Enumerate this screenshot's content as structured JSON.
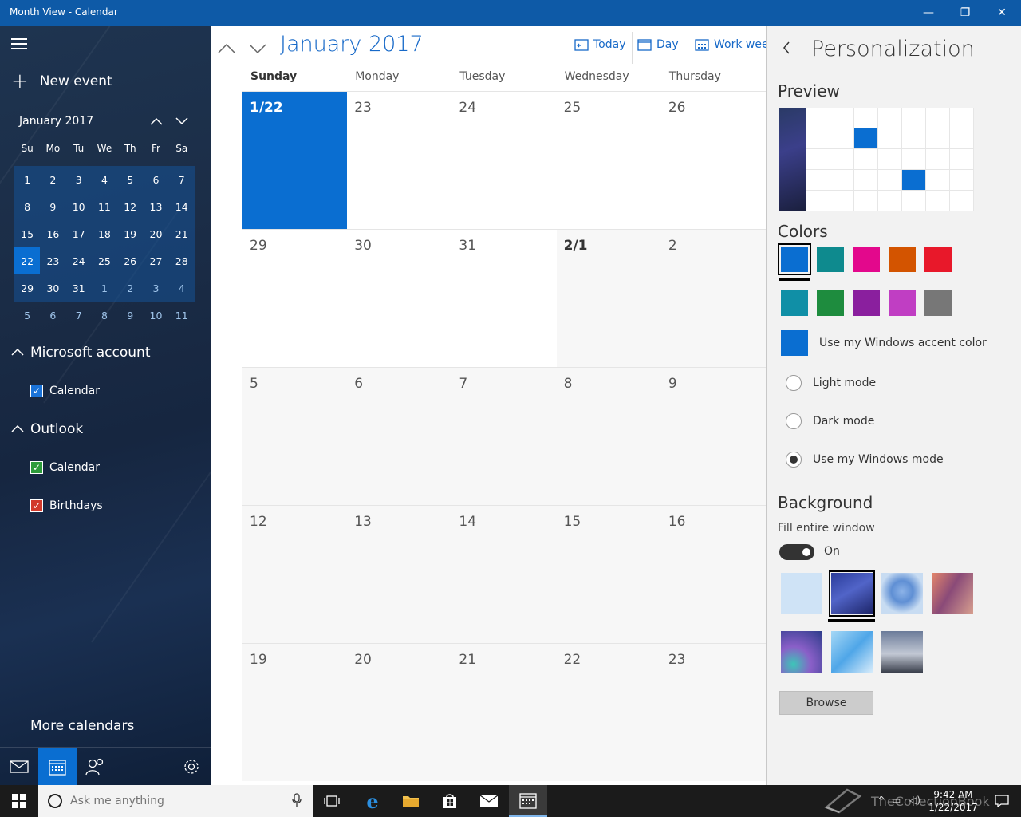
{
  "window": {
    "title": "Month View - Calendar",
    "min": "—",
    "max": "❐",
    "close": "✕"
  },
  "sidebar": {
    "new_event": "New event",
    "mini_title": "January 2017",
    "dow": [
      "Su",
      "Mo",
      "Tu",
      "We",
      "Th",
      "Fr",
      "Sa"
    ],
    "weeks": [
      [
        "1",
        "2",
        "3",
        "4",
        "5",
        "6",
        "7"
      ],
      [
        "8",
        "9",
        "10",
        "11",
        "12",
        "13",
        "14"
      ],
      [
        "15",
        "16",
        "17",
        "18",
        "19",
        "20",
        "21"
      ],
      [
        "22",
        "23",
        "24",
        "25",
        "26",
        "27",
        "28"
      ],
      [
        "29",
        "30",
        "31",
        "1",
        "2",
        "3",
        "4"
      ],
      [
        "5",
        "6",
        "7",
        "8",
        "9",
        "10",
        "11"
      ]
    ],
    "accounts": [
      {
        "name": "Microsoft account",
        "calendars": [
          {
            "label": "Calendar",
            "color": "#1a73d9"
          }
        ]
      },
      {
        "name": "Outlook",
        "calendars": [
          {
            "label": "Calendar",
            "color": "#2d9b3a"
          },
          {
            "label": "Birthdays",
            "color": "#d23a2c"
          }
        ]
      }
    ],
    "more_calendars": "More calendars"
  },
  "main": {
    "month_title": "January 2017",
    "today": "Today",
    "day": "Day",
    "work_week": "Work week",
    "dow": [
      "Sunday",
      "Monday",
      "Tuesday",
      "Wednesday",
      "Thursday"
    ],
    "weeks": [
      [
        "1/22",
        "23",
        "24",
        "25",
        "26"
      ],
      [
        "29",
        "30",
        "31",
        "2/1",
        "2"
      ],
      [
        "5",
        "6",
        "7",
        "8",
        "9"
      ],
      [
        "12",
        "13",
        "14",
        "15",
        "16"
      ],
      [
        "19",
        "20",
        "21",
        "22",
        "23"
      ]
    ]
  },
  "personalization": {
    "title": "Personalization",
    "preview": "Preview",
    "colors": "Colors",
    "swatches": [
      "#0a6ed1",
      "#0e8a8e",
      "#e3088c",
      "#d35400",
      "#e8182a",
      "#108fa6",
      "#1e8c3e",
      "#8a1f9e",
      "#c03ec3",
      "#777777"
    ],
    "use_accent": "Use my Windows accent color",
    "light_mode": "Light mode",
    "dark_mode": "Dark mode",
    "windows_mode": "Use my Windows mode",
    "background": "Background",
    "fill_window": "Fill entire window",
    "toggle_state": "On",
    "browse": "Browse"
  },
  "taskbar": {
    "search_placeholder": "Ask me anything",
    "time": "9:42 AM",
    "date": "1/22/2017",
    "watermark": "TheCollectionBook"
  }
}
